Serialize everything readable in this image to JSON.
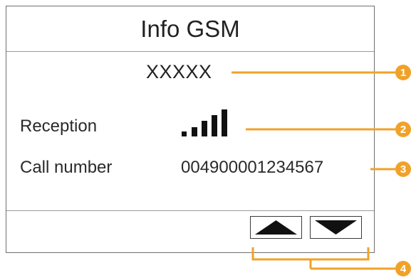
{
  "header": {
    "title": "Info GSM"
  },
  "network": {
    "name": "XXXXX"
  },
  "reception": {
    "label": "Reception",
    "signal_bars_filled": 5,
    "signal_bars_total": 5
  },
  "call": {
    "label": "Call number",
    "number": "004900001234567"
  },
  "nav": {
    "up_icon": "triangle-up-icon",
    "down_icon": "triangle-down-icon"
  },
  "callouts": {
    "c1": "1",
    "c2": "2",
    "c3": "3",
    "c4": "4",
    "color": "#f0a228"
  }
}
